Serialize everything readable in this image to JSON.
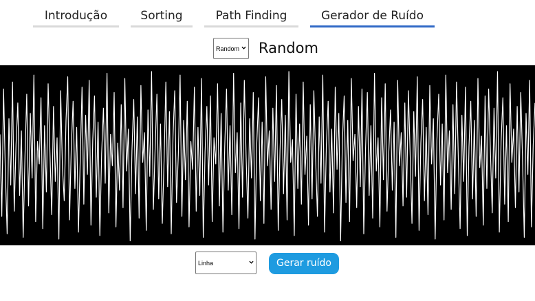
{
  "nav": {
    "tabs": [
      {
        "label": "Introdução",
        "active": false
      },
      {
        "label": "Sorting",
        "active": false
      },
      {
        "label": "Path Finding",
        "active": false
      },
      {
        "label": "Gerador de Ruído",
        "active": true
      }
    ],
    "active_color": "#2f68c6",
    "inactive_color": "#d9d9d9"
  },
  "generator": {
    "algorithm_select_value": "Random",
    "title": "Random",
    "mode_select_value": "Linha",
    "generate_button_label": "Gerar ruído",
    "button_color": "#1e9be0"
  },
  "canvas": {
    "background": "#000000",
    "line_color": "#ffffff",
    "noise_values": [
      0.62,
      0.15,
      0.88,
      0.4,
      0.05,
      0.71,
      0.33,
      0.92,
      0.18,
      0.56,
      0.8,
      0.27,
      0.64,
      0.03,
      0.49,
      0.85,
      0.21,
      0.74,
      0.37,
      0.96,
      0.12,
      0.58,
      0.45,
      0.83,
      0.08,
      0.67,
      0.29,
      0.91,
      0.52,
      0.16,
      0.78,
      0.35,
      0.6,
      0.02,
      0.87,
      0.43,
      0.24,
      0.7,
      0.95,
      0.13,
      0.55,
      0.81,
      0.31,
      0.66,
      0.06,
      0.48,
      0.89,
      0.22,
      0.73,
      0.39,
      0.93,
      0.1,
      0.59,
      0.84,
      0.26,
      0.69,
      0.04,
      0.51,
      0.77,
      0.34,
      0.97,
      0.17,
      0.62,
      0.44,
      0.86,
      0.09,
      0.57,
      0.3,
      0.79,
      0.2,
      0.94,
      0.41,
      0.65,
      0.01,
      0.53,
      0.82,
      0.28,
      0.72,
      0.14,
      0.9,
      0.46,
      0.63,
      0.07,
      0.76,
      0.38,
      0.98,
      0.19,
      0.54,
      0.85,
      0.25,
      0.68,
      0.11,
      0.47,
      0.92,
      0.32,
      0.75,
      0.05,
      0.61,
      0.87,
      0.23,
      0.5,
      0.96,
      0.15,
      0.7,
      0.36,
      0.81,
      0.09,
      0.58,
      0.42,
      0.89,
      0.18,
      0.66,
      0.27,
      0.94,
      0.03,
      0.52,
      0.78,
      0.33,
      0.84,
      0.12,
      0.6,
      0.45,
      0.91,
      0.21,
      0.74,
      0.06,
      0.55,
      0.88,
      0.3,
      0.67,
      0.16,
      0.97,
      0.4,
      0.63,
      0.08,
      0.8,
      0.26,
      0.93,
      0.49,
      0.14,
      0.71,
      0.37,
      0.86,
      0.02,
      0.57,
      0.83,
      0.24,
      0.69,
      0.11,
      0.95,
      0.44,
      0.64,
      0.19,
      0.77,
      0.35,
      0.9,
      0.07,
      0.53,
      0.82,
      0.28,
      0.73,
      0.13,
      0.98,
      0.46,
      0.59,
      0.04,
      0.85,
      0.31,
      0.68,
      0.22,
      0.92,
      0.39,
      0.61,
      0.1,
      0.79,
      0.25,
      0.87,
      0.48,
      0.15,
      0.72,
      0.34,
      0.96,
      0.06,
      0.56,
      0.81,
      0.29,
      0.65,
      0.17,
      0.89,
      0.42,
      0.74,
      0.01,
      0.58,
      0.84,
      0.23,
      0.7,
      0.12,
      0.94,
      0.47,
      0.62,
      0.2,
      0.78,
      0.32,
      0.88,
      0.05,
      0.54,
      0.86,
      0.27,
      0.67,
      0.14,
      0.97,
      0.41,
      0.6,
      0.09,
      0.83,
      0.36,
      0.91,
      0.18,
      0.51,
      0.76,
      0.3,
      0.69,
      0.03,
      0.93,
      0.44,
      0.63,
      0.21,
      0.8,
      0.26,
      0.87,
      0.5,
      0.11,
      0.75,
      0.38,
      0.95,
      0.07,
      0.57,
      0.82,
      0.24,
      0.66,
      0.16,
      0.9,
      0.45,
      0.71,
      0.02,
      0.59,
      0.85,
      0.33,
      0.68,
      0.13,
      0.96,
      0.4,
      0.64,
      0.19,
      0.79,
      0.28,
      0.92,
      0.48,
      0.08,
      0.73,
      0.35,
      0.89,
      0.04,
      0.55,
      0.81,
      0.25,
      0.7,
      0.15,
      0.94,
      0.43,
      0.61,
      0.1,
      0.84,
      0.31,
      0.88,
      0.52,
      0.17,
      0.77,
      0.37,
      0.98,
      0.06,
      0.58,
      0.83,
      0.22,
      0.67,
      0.12,
      0.91,
      0.46,
      0.65,
      0.2,
      0.78,
      0.29,
      0.86,
      0.49,
      0.03,
      0.74,
      0.39,
      0.93,
      0.09,
      0.56,
      0.8
    ]
  }
}
